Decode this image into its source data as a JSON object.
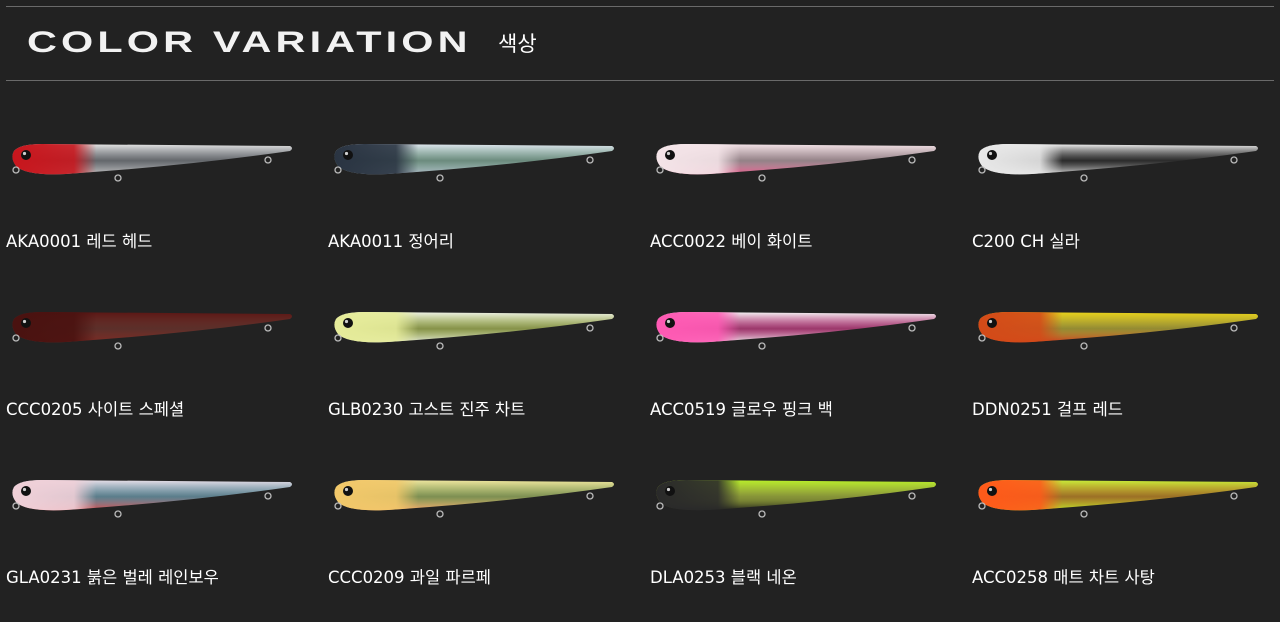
{
  "header": {
    "title": "COLOR VARIATION",
    "subtitle": "색상"
  },
  "items": [
    {
      "label": "AKA0001 레드 헤드",
      "icon": "lure-red-head-icon",
      "colors": {
        "body": "#e6e6e6",
        "belly": "#bfbfbf",
        "head": "#c8161d",
        "accent": "#9aa0a8"
      }
    },
    {
      "label": "AKA0011 정어리",
      "icon": "lure-sardine-icon",
      "colors": {
        "body": "#dfe6ee",
        "belly": "#aeb8c4",
        "head": "#2a3442",
        "accent": "#a8e0c8"
      }
    },
    {
      "label": "ACC0022 베이 화이트",
      "icon": "lure-bay-white-icon",
      "colors": {
        "body": "#f4e4e8",
        "belly": "#e25a8a",
        "head": "#f4e4e8",
        "accent": "#f0d0da"
      }
    },
    {
      "label": "C200 CH 실라",
      "icon": "lure-silla-icon",
      "colors": {
        "body": "#f2f2f2",
        "belly": "#d8d8d8",
        "head": "#e8e8e8",
        "accent": "#333333"
      }
    },
    {
      "label": "CCC0205 사이트 스페셜",
      "icon": "lure-sight-special-icon",
      "colors": {
        "body": "#5a1614",
        "belly": "#7a2a24",
        "head": "#4a1210",
        "accent": "#8a3a30"
      }
    },
    {
      "label": "GLB0230 고스트 진주 차트",
      "icon": "lure-ghost-pearl-chart-icon",
      "colors": {
        "body": "#eef2e6",
        "belly": "#dfe4d8",
        "head": "#e6ec9a",
        "accent": "#d8ee6a"
      }
    },
    {
      "label": "ACC0519 글로우 핑크 백",
      "icon": "lure-glow-pink-back-icon",
      "colors": {
        "body": "#f4f4f4",
        "belly": "#e8e8e8",
        "head": "#ff5ab4",
        "accent": "#ff4aa8"
      }
    },
    {
      "label": "DDN0251 걸프 레드",
      "icon": "lure-gulf-red-icon",
      "colors": {
        "body": "#e8d21a",
        "belly": "#c83a20",
        "head": "#d44a18",
        "accent": "#f0e040"
      }
    },
    {
      "label": "GLA0231 붉은 벌레 레인보우",
      "icon": "lure-red-worm-rainbow-icon",
      "colors": {
        "body": "#e8dfe8",
        "belly": "#d84a4a",
        "head": "#f0d0d8",
        "accent": "#8ac8e0"
      }
    },
    {
      "label": "CCC0209 과일 파르페",
      "icon": "lure-fruit-parfait-icon",
      "colors": {
        "body": "#f0e6a0",
        "belly": "#f2a46a",
        "head": "#f2c86a",
        "accent": "#c8e87a"
      }
    },
    {
      "label": "DLA0253 블랙 네온",
      "icon": "lure-black-neon-icon",
      "colors": {
        "body": "#b8ee2a",
        "belly": "#1a1a1a",
        "head": "#2a2a2a",
        "accent": "#d8f04a"
      }
    },
    {
      "label": "ACC0258 매트 차트 사탕",
      "icon": "lure-matte-chart-candy-icon",
      "colors": {
        "body": "#c8ee3a",
        "belly": "#b8e02a",
        "head": "#ff5a1a",
        "accent": "#ffb02a"
      }
    }
  ]
}
